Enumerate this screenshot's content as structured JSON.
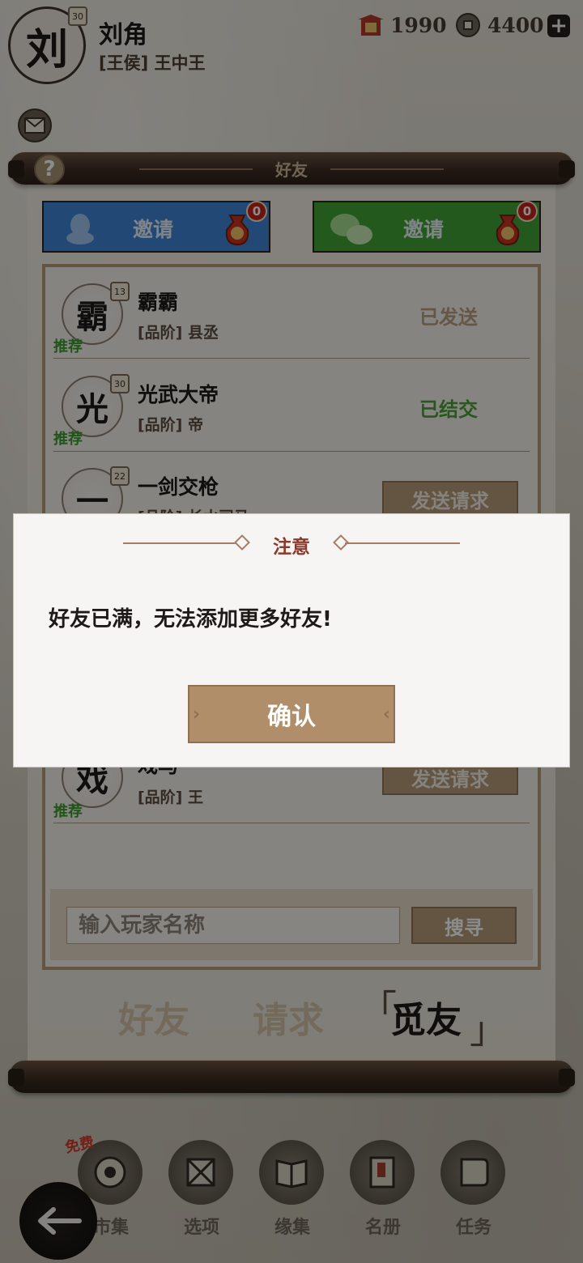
{
  "player": {
    "avatar_char": "刘",
    "level": "30",
    "name": "刘角",
    "title": "[王侯] 王中王"
  },
  "currency": {
    "gold": "1990",
    "coins": "4400"
  },
  "panel": {
    "title": "好友"
  },
  "invite": {
    "qq_label": "邀请",
    "qq_count": "0",
    "wechat_label": "邀请",
    "wechat_count": "0",
    "gift_char": "礼"
  },
  "friends": [
    {
      "char": "霸",
      "level": "13",
      "name": "霸霸",
      "rank": "[品阶] 县丞",
      "tag": "推荐",
      "status": "已发送"
    },
    {
      "char": "光",
      "level": "30",
      "name": "光武大帝",
      "rank": "[品阶] 帝",
      "tag": "推荐",
      "status": "已结交"
    },
    {
      "char": "一",
      "level": "22",
      "name": "一剑交枪",
      "rank": "[品阶] 长水司马",
      "tag": "推荐",
      "action": "发送请求"
    },
    {
      "char": "戏",
      "level": "",
      "name": "戏马",
      "rank": "[品阶] 王",
      "tag": "推荐",
      "action": "发送请求"
    }
  ],
  "search": {
    "placeholder": "输入玩家名称",
    "button": "搜寻"
  },
  "tabs": {
    "friends": "好友",
    "requests": "请求",
    "find": "觅友"
  },
  "nav": {
    "free_tag": "免费",
    "items": [
      "市集",
      "选项",
      "缘集",
      "名册",
      "任务"
    ]
  },
  "dialog": {
    "title": "注意",
    "message": "好友已满，无法添加更多好友!",
    "confirm": "确认"
  },
  "colors": {
    "qq_blue": "#3f84d6",
    "wechat_green": "#43a338",
    "accent_tan": "#b59b79",
    "badge_red": "#c3241d",
    "dialog_title": "#8a3a2c"
  }
}
